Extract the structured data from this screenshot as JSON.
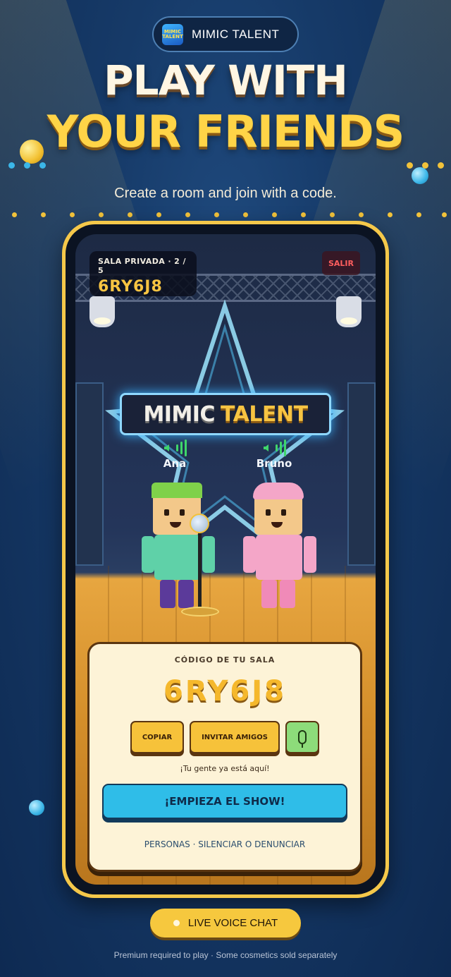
{
  "brand": {
    "logo_text": "MIMIC TALENT",
    "name": "MIMIC TALENT"
  },
  "headline": {
    "line1": "PLAY WITH",
    "line2": "YOUR FRIENDS"
  },
  "subtitle": "Create a room and join with a code.",
  "game": {
    "room_label": "SALA PRIVADA · 2 / 5",
    "room_code": "6RY6J8",
    "exit_label": "SALIR",
    "stage_sign": {
      "word1": "MIMIC",
      "word2": "TALENT"
    },
    "players": [
      {
        "name": "Ana",
        "speaking": true
      },
      {
        "name": "Bruno",
        "speaking": true
      }
    ],
    "panel": {
      "label": "CÓDIGO DE TU SALA",
      "code": "6RY6J8",
      "copy_label": "COPIAR",
      "invite_label": "INVITAR AMIGOS",
      "mic_icon": "microphone-icon",
      "note": "¡Tu gente ya está aquí!",
      "start_label": "¡EMPIEZA EL SHOW!",
      "people_link": "PERSONAS · SILENCIAR O DENUNCIAR"
    }
  },
  "badge": {
    "label": "LIVE VOICE CHAT"
  },
  "footnote": "Premium required to play · Some cosmetics sold separately",
  "colors": {
    "accent_yellow": "#f6c83e",
    "accent_blue": "#2fbde8",
    "background": "#163a68"
  }
}
